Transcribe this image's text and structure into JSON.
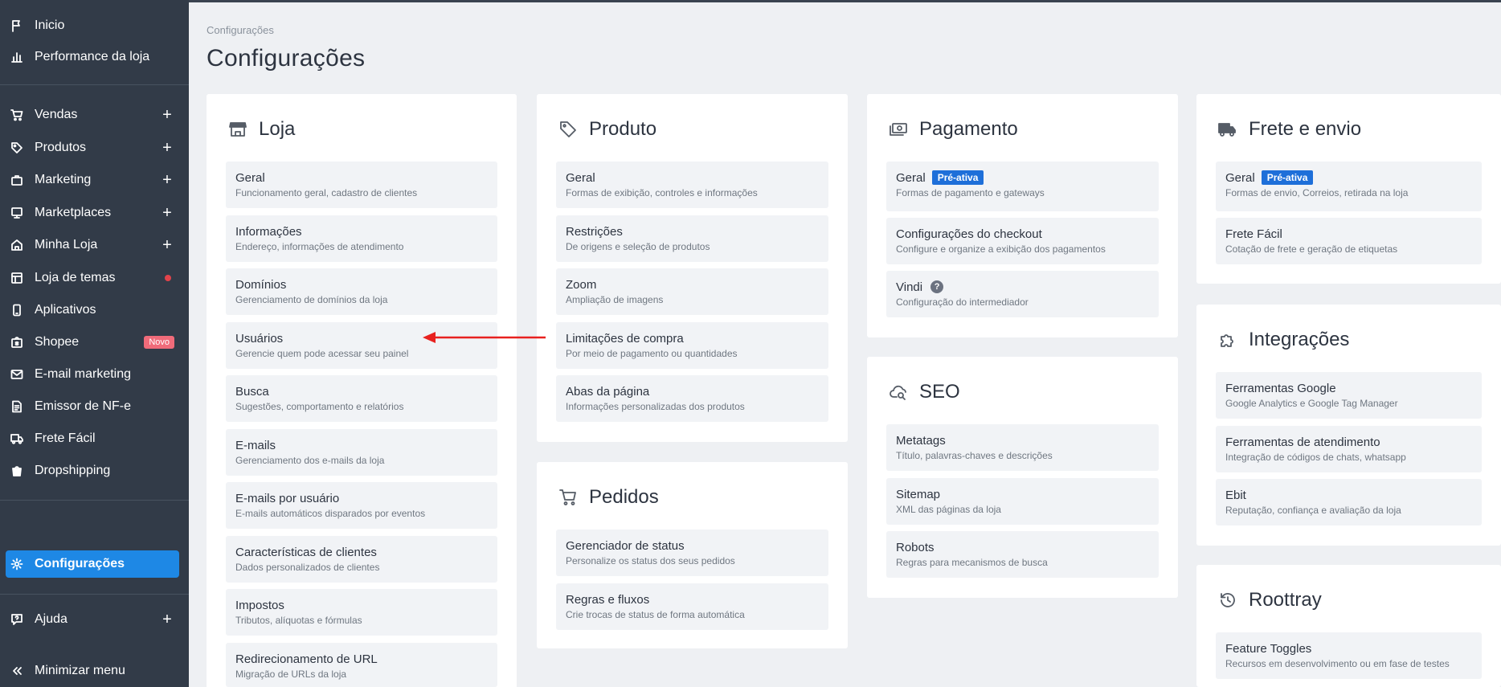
{
  "sidebar": {
    "items": [
      {
        "label": "Inicio"
      },
      {
        "label": "Performance da loja"
      },
      {
        "label": "Vendas"
      },
      {
        "label": "Produtos"
      },
      {
        "label": "Marketing"
      },
      {
        "label": "Marketplaces"
      },
      {
        "label": "Minha Loja"
      },
      {
        "label": "Loja de temas"
      },
      {
        "label": "Aplicativos"
      },
      {
        "label": "Shopee",
        "badge": "Novo"
      },
      {
        "label": "E-mail marketing"
      },
      {
        "label": "Emissor de NF-e"
      },
      {
        "label": "Frete Fácil"
      },
      {
        "label": "Dropshipping"
      },
      {
        "label": "Configurações"
      },
      {
        "label": "Ajuda"
      },
      {
        "label": "Minimizar menu"
      }
    ],
    "expand_symbol": "+"
  },
  "header": {
    "breadcrumb": "Configurações",
    "title": "Configurações"
  },
  "cards": {
    "loja": {
      "title": "Loja",
      "items": [
        {
          "title": "Geral",
          "desc": "Funcionamento geral, cadastro de clientes"
        },
        {
          "title": "Informações",
          "desc": "Endereço, informações de atendimento"
        },
        {
          "title": "Domínios",
          "desc": "Gerenciamento de domínios da loja"
        },
        {
          "title": "Usuários",
          "desc": "Gerencie quem pode acessar seu painel"
        },
        {
          "title": "Busca",
          "desc": "Sugestões, comportamento e relatórios"
        },
        {
          "title": "E-mails",
          "desc": "Gerenciamento dos e-mails da loja"
        },
        {
          "title": "E-mails por usuário",
          "desc": "E-mails automáticos disparados por eventos"
        },
        {
          "title": "Características de clientes",
          "desc": "Dados personalizados de clientes"
        },
        {
          "title": "Impostos",
          "desc": "Tributos, alíquotas e fórmulas"
        },
        {
          "title": "Redirecionamento de URL",
          "desc": "Migração de URLs da loja"
        }
      ]
    },
    "produto": {
      "title": "Produto",
      "items": [
        {
          "title": "Geral",
          "desc": "Formas de exibição, controles e informações"
        },
        {
          "title": "Restrições",
          "desc": "De origens e seleção de produtos"
        },
        {
          "title": "Zoom",
          "desc": "Ampliação de imagens"
        },
        {
          "title": "Limitações de compra",
          "desc": "Por meio de pagamento ou quantidades"
        },
        {
          "title": "Abas da página",
          "desc": "Informações personalizadas dos produtos"
        }
      ]
    },
    "pedidos": {
      "title": "Pedidos",
      "items": [
        {
          "title": "Gerenciador de status",
          "desc": "Personalize os status dos seus pedidos"
        },
        {
          "title": "Regras e fluxos",
          "desc": "Crie trocas de status de forma automática"
        }
      ]
    },
    "pagamento": {
      "title": "Pagamento",
      "items": [
        {
          "title": "Geral",
          "badge": "Pré-ativa",
          "desc": "Formas de pagamento e gateways"
        },
        {
          "title": "Configurações do checkout",
          "desc": "Configure e organize a exibição dos pagamentos"
        },
        {
          "title": "Vindi",
          "help": "?",
          "desc": "Configuração do intermediador"
        }
      ]
    },
    "seo": {
      "title": "SEO",
      "items": [
        {
          "title": "Metatags",
          "desc": "Título, palavras-chaves e descrições"
        },
        {
          "title": "Sitemap",
          "desc": "XML das páginas da loja"
        },
        {
          "title": "Robots",
          "desc": "Regras para mecanismos de busca"
        }
      ]
    },
    "frete": {
      "title": "Frete e envio",
      "items": [
        {
          "title": "Geral",
          "badge": "Pré-ativa",
          "desc": "Formas de envio, Correios, retirada na loja"
        },
        {
          "title": "Frete Fácil",
          "desc": "Cotação de frete e geração de etiquetas"
        }
      ]
    },
    "integracoes": {
      "title": "Integrações",
      "items": [
        {
          "title": "Ferramentas Google",
          "desc": "Google Analytics e Google Tag Manager"
        },
        {
          "title": "Ferramentas de atendimento",
          "desc": "Integração de códigos de chats, whatsapp"
        },
        {
          "title": "Ebit",
          "desc": "Reputação, confiança e avaliação da loja"
        }
      ]
    },
    "roottray": {
      "title": "Roottray",
      "items": [
        {
          "title": "Feature Toggles",
          "desc": "Recursos em desenvolvimento ou em fase de testes"
        }
      ]
    }
  },
  "colors": {
    "sidebar_bg": "#323b48",
    "active_bg": "#1e88e5",
    "badge_blue": "#1e6fd9",
    "badge_novo": "#f06b7a",
    "annotation_arrow": "#e8211f"
  }
}
